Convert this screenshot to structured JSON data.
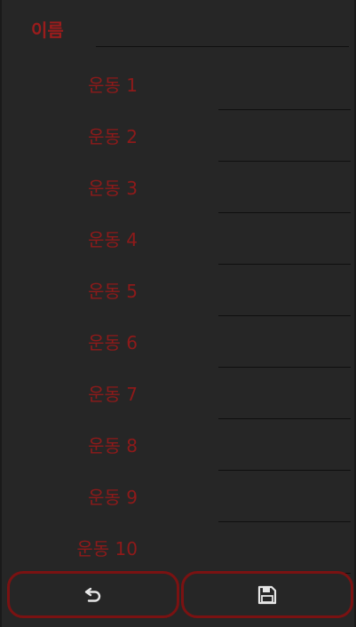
{
  "form": {
    "name_label": "이름",
    "exercises": [
      "운동 1",
      "운동 2",
      "운동 3",
      "운동 4",
      "운동 5",
      "운동 6",
      "운동 7",
      "운동 8",
      "운동 9",
      "운동 10"
    ]
  },
  "buttons": {
    "back_icon": "undo-arrow-icon",
    "save_icon": "floppy-disk-icon"
  },
  "colors": {
    "accent": "#9a1c1c",
    "background": "#262626",
    "button_border": "#7a1212",
    "icon": "#e6e6e6"
  }
}
